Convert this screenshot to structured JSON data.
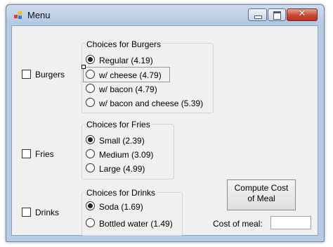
{
  "window": {
    "title": "Menu",
    "close_glyph": "✕"
  },
  "burgers": {
    "checkbox_label": "Burgers",
    "group_title": "Choices for Burgers",
    "options": [
      "Regular (4.19)",
      "w/ cheese (4.79)",
      "w/ bacon (4.79)",
      "w/ bacon and cheese (5.39)"
    ]
  },
  "fries": {
    "checkbox_label": "Fries",
    "group_title": "Choices for Fries",
    "options": [
      "Small (2.39)",
      "Medium (3.09)",
      "Large (4.99)"
    ]
  },
  "drinks": {
    "checkbox_label": "Drinks",
    "group_title": "Choices for Drinks",
    "options": [
      "Soda (1.69)",
      "Bottled water (1.49)"
    ]
  },
  "compute_button": {
    "line1": "Compute Cost",
    "line2": "of Meal"
  },
  "cost": {
    "label": "Cost of meal:",
    "value": ""
  },
  "colors": {
    "close_button": "#c84a36",
    "titlebar": "#cfdded",
    "client_bg": "#f0f0f0"
  },
  "icons": [
    "app-icon",
    "minimize-icon",
    "maximize-icon",
    "close-icon"
  ]
}
